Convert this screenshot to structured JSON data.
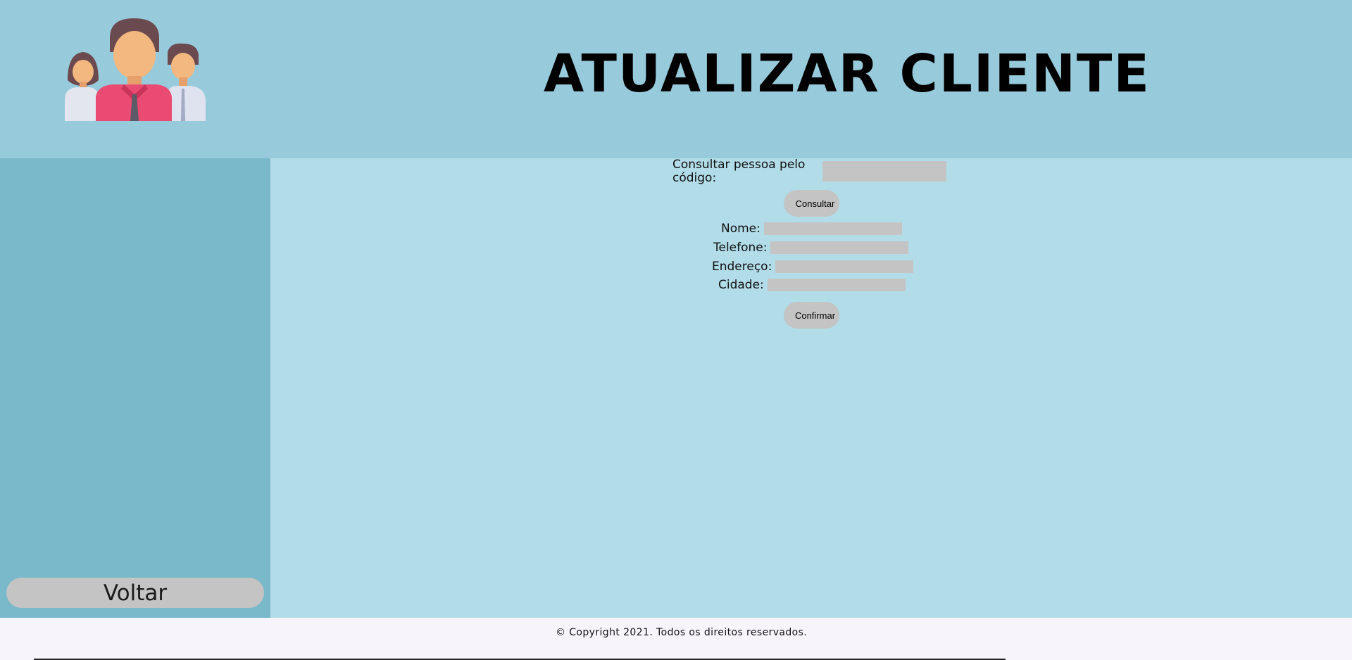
{
  "header": {
    "title": "ATUALIZAR CLIENTE",
    "logo_icon": "family-people-icon"
  },
  "sidebar": {
    "back_label": "Voltar"
  },
  "lookup": {
    "label": "Consultar pessoa pelo código:",
    "input_value": "",
    "button_label": "Consultar"
  },
  "form": {
    "fields": [
      {
        "label": "Nome:",
        "value": ""
      },
      {
        "label": "Telefone:",
        "value": ""
      },
      {
        "label": "Endereço:",
        "value": ""
      },
      {
        "label": "Cidade:",
        "value": ""
      }
    ],
    "confirm_label": "Confirmar"
  },
  "footer": {
    "copyright": "© Copyright 2021. Todos os direitos reservados."
  },
  "colors": {
    "header_bg": "#97cadb",
    "sidebar_bg": "#7ab9ca",
    "main_bg": "#b1dce8",
    "input_bg": "#c4c4c4",
    "footer_bg": "#f7f4fc"
  }
}
